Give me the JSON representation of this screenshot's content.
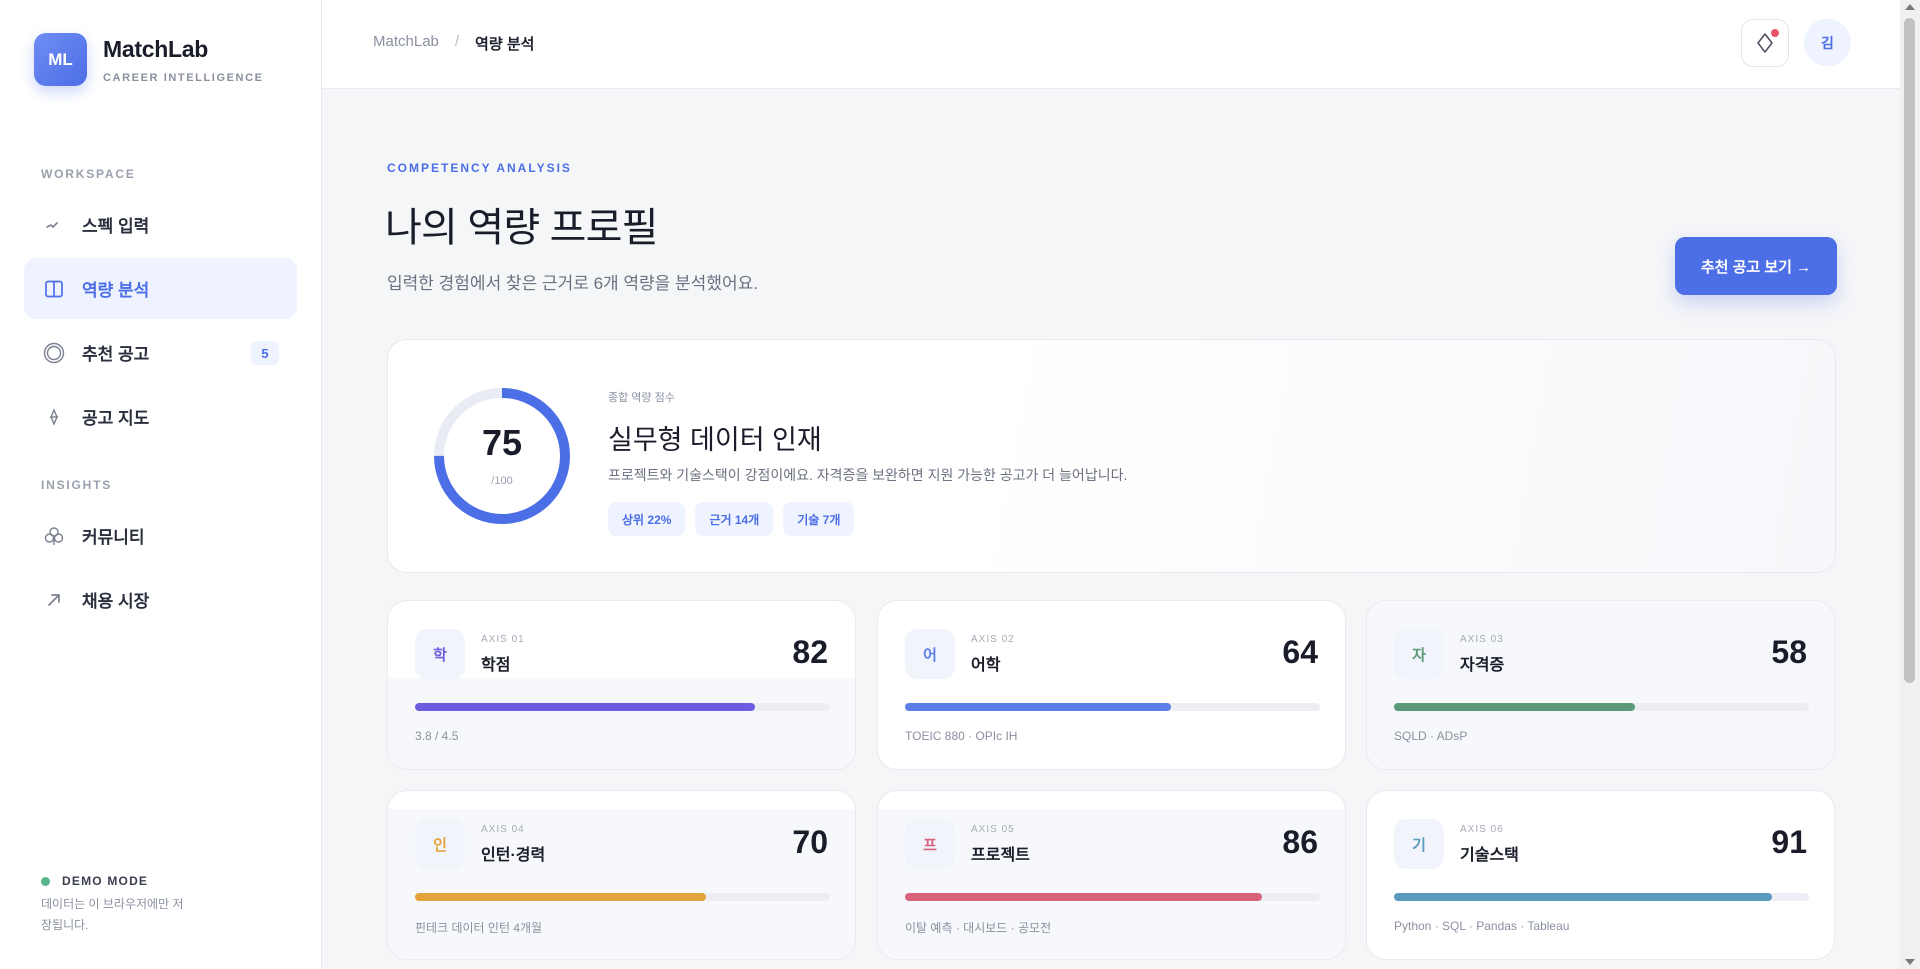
{
  "brand": {
    "logo": "ML",
    "name": "MatchLab",
    "subtitle": "CAREER INTELLIGENCE"
  },
  "sidebar": {
    "sections": [
      "WORKSPACE",
      "INSIGHTS"
    ],
    "items": [
      {
        "label": "스펙 입력",
        "icon": "pulse-icon"
      },
      {
        "label": "역량 분석",
        "icon": "columns-icon",
        "active": true
      },
      {
        "label": "추천 공고",
        "icon": "target-icon",
        "badge": "5"
      },
      {
        "label": "공고 지도",
        "icon": "diamond-icon"
      },
      {
        "label": "커뮤니티",
        "icon": "club-icon"
      },
      {
        "label": "채용 시장",
        "icon": "trend-arrow-icon"
      }
    ],
    "demo": {
      "title": "DEMO MODE",
      "text": "데이터는 이 브라우저에만 저장됩니다."
    }
  },
  "topbar": {
    "breadcrumb_root": "MatchLab",
    "breadcrumb_sep": "/",
    "breadcrumb_current": "역량 분석",
    "avatar": "김"
  },
  "main": {
    "eyebrow": "COMPETENCY ANALYSIS",
    "title": "나의 역량 프로필",
    "description": "입력한 경험에서 찾은 근거로 6개 역량을 분석했어요.",
    "cta": "추천 공고 보기 →"
  },
  "summary": {
    "score": "75",
    "max": "/100",
    "score_fraction": 0.75,
    "label": "종합 역량 점수",
    "title": "실무형 데이터 인재",
    "description": "프로젝트와 기술스택이 강점이에요. 자격증을 보완하면 지원 가능한 공고가 더 늘어납니다.",
    "chips": [
      "상위 22%",
      "근거 14개",
      "기술 7개"
    ]
  },
  "axes": [
    {
      "glyph": "학",
      "axis": "AXIS 01",
      "name": "학점",
      "score": "82",
      "value": 82,
      "note": "3.8 / 4.5",
      "color": "#6c5ce0"
    },
    {
      "glyph": "어",
      "axis": "AXIS 02",
      "name": "어학",
      "score": "64",
      "value": 64,
      "note": "TOEIC 880 · OPIc IH",
      "color": "#5b7ee8"
    },
    {
      "glyph": "자",
      "axis": "AXIS 03",
      "name": "자격증",
      "score": "58",
      "value": 58,
      "note": "SQLD · ADsP",
      "color": "#5a9a78"
    },
    {
      "glyph": "인",
      "axis": "AXIS 04",
      "name": "인턴·경력",
      "score": "70",
      "value": 70,
      "note": "핀테크 데이터 인턴 4개월",
      "color": "#e4a23a"
    },
    {
      "glyph": "프",
      "axis": "AXIS 05",
      "name": "프로젝트",
      "score": "86",
      "value": 86,
      "note": "이탈 예측 · 대시보드 · 공모전",
      "color": "#d9637a"
    },
    {
      "glyph": "기",
      "axis": "AXIS 06",
      "name": "기술스택",
      "score": "91",
      "value": 91,
      "note": "Python · SQL · Pandas · Tableau",
      "color": "#5a9abd"
    }
  ]
}
